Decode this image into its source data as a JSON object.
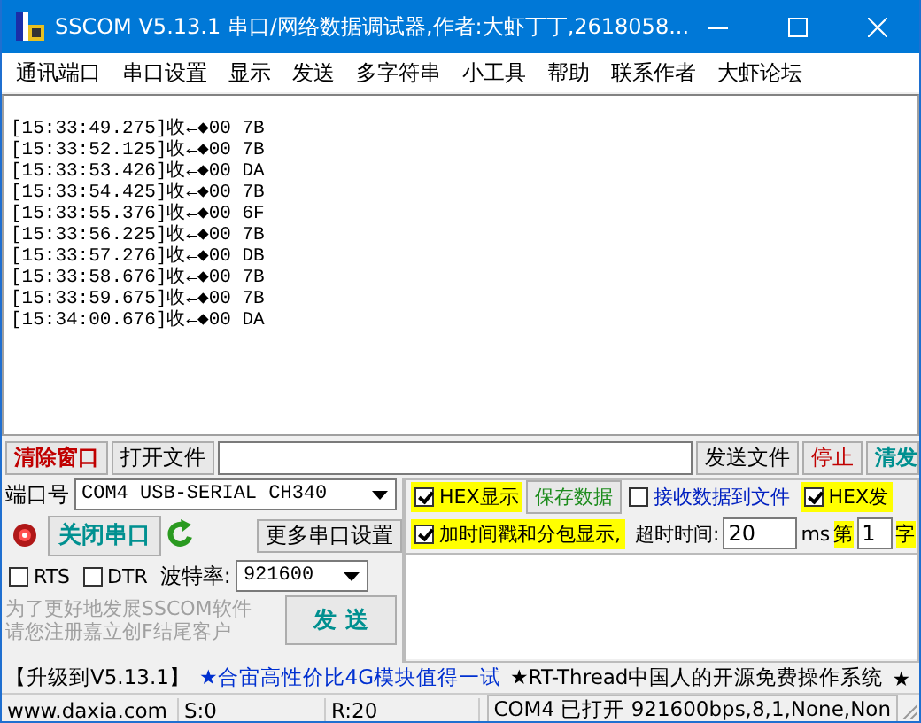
{
  "window": {
    "title": "SSCOM V5.13.1 串口/网络数据调试器,作者:大虾丁丁,2618058..."
  },
  "menu": [
    "通讯端口",
    "串口设置",
    "显示",
    "发送",
    "多字符串",
    "小工具",
    "帮助",
    "联系作者",
    "大虾论坛"
  ],
  "receive_log": [
    "[15:33:49.275]收←◆00 7B",
    "[15:33:52.125]收←◆00 7B",
    "[15:33:53.426]收←◆00 DA",
    "[15:33:54.425]收←◆00 7B",
    "[15:33:55.376]收←◆00 6F",
    "[15:33:56.225]收←◆00 7B",
    "[15:33:57.276]收←◆00 DB",
    "[15:33:58.676]收←◆00 7B",
    "[15:33:59.675]收←◆00 7B",
    "[15:34:00.676]收←◆00 DA"
  ],
  "file_row": {
    "clear_button": "清除窗口",
    "open_file_button": "打开文件",
    "send_file_button": "发送文件",
    "stop_button": "停止",
    "clear_send_button": "清发"
  },
  "port": {
    "label": "端口号",
    "value": "COM4 USB-SERIAL CH340",
    "open": true,
    "toggle_button": "关闭串口",
    "more_button": "更多串口设置",
    "baud_label": "波特率:",
    "baud": "921600"
  },
  "lines": [
    {
      "label": "RTS",
      "checked": false
    },
    {
      "label": "DTR",
      "checked": false
    }
  ],
  "hint": [
    "为了更好地发展SSCOM软件",
    "请您注册嘉立创F结尾客户"
  ],
  "send_button": "发 送",
  "options": {
    "hex_display": {
      "label": "HEX显示",
      "checked": true
    },
    "save_button": "保存数据",
    "to_file": {
      "label": "接收数据到文件",
      "checked": false
    },
    "hex_send": {
      "label": "HEX发",
      "checked": true
    },
    "timestamp": {
      "label": "加时间戳和分包显示,",
      "checked": true
    },
    "timeout_label": "超时时间:",
    "timeout": "20",
    "timeout_unit": "ms",
    "nth_label": "第",
    "nth": "1",
    "byte_label": "字"
  },
  "marquee": [
    {
      "text": "【升级到V5.13.1】",
      "kind": "plain"
    },
    {
      "text": "★合宙高性价比4G模块值得一试",
      "kind": "link"
    },
    {
      "text": "★RT-Thread中国人的开源免费操作系统",
      "kind": "plain"
    },
    {
      "text": "★",
      "kind": "plain"
    }
  ],
  "status_bar": [
    "www.daxia.com",
    "S:0",
    "R:20",
    "COM4 已打开  921600bps,8,1,None,Non"
  ]
}
